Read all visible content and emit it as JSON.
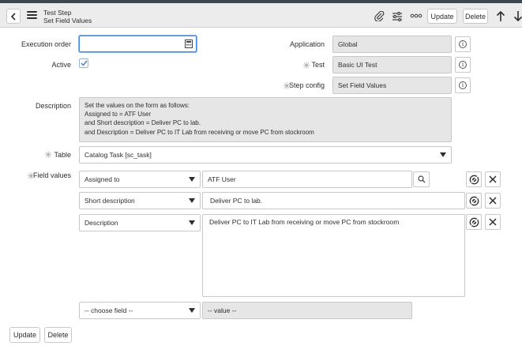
{
  "header": {
    "title_line1": "Test Step",
    "title_line2": "Set Field Values",
    "update_label": "Update",
    "delete_label": "Delete"
  },
  "form": {
    "execution_order": {
      "label": "Execution order",
      "value": ""
    },
    "active": {
      "label": "Active",
      "checked": true
    },
    "application": {
      "label": "Application",
      "value": "Global"
    },
    "test": {
      "label": "Test",
      "value": "Basic UI Test"
    },
    "step_config": {
      "label": "Step config",
      "value": "Set Field Values"
    },
    "description": {
      "label": "Description",
      "lines": [
        "Set the values on the form as follows:",
        "Assigned to = ATF User",
        "and Short description = Deliver PC to lab.",
        "and Description = Deliver PC to IT Lab from receiving or move PC from stockroom"
      ]
    },
    "table": {
      "label": "Table",
      "value": "Catalog Task [sc_task]"
    },
    "field_values": {
      "label": "Field values",
      "rows": [
        {
          "field": "Assigned to",
          "value": "ATF User"
        },
        {
          "field": "Short description",
          "value": "Deliver PC to lab."
        },
        {
          "field": "Description",
          "value": "Deliver PC to IT Lab from receiving or move PC from stockroom"
        }
      ],
      "new_row": {
        "field_placeholder": "-- choose field --",
        "value_placeholder": "-- value --"
      }
    }
  },
  "footer": {
    "update_label": "Update",
    "delete_label": "Delete"
  },
  "icons": {
    "back": "chevron-left-icon",
    "menu": "hamburger-menu-icon",
    "attachment": "paperclip-icon",
    "settings": "sliders-icon",
    "more": "more-options-icon",
    "up": "arrow-up-icon",
    "down": "arrow-down-icon"
  },
  "colors": {
    "focus_border": "#3c8be4",
    "readonly_bg": "#e6e6e6",
    "checkbox_mark": "#3c7fc9"
  }
}
